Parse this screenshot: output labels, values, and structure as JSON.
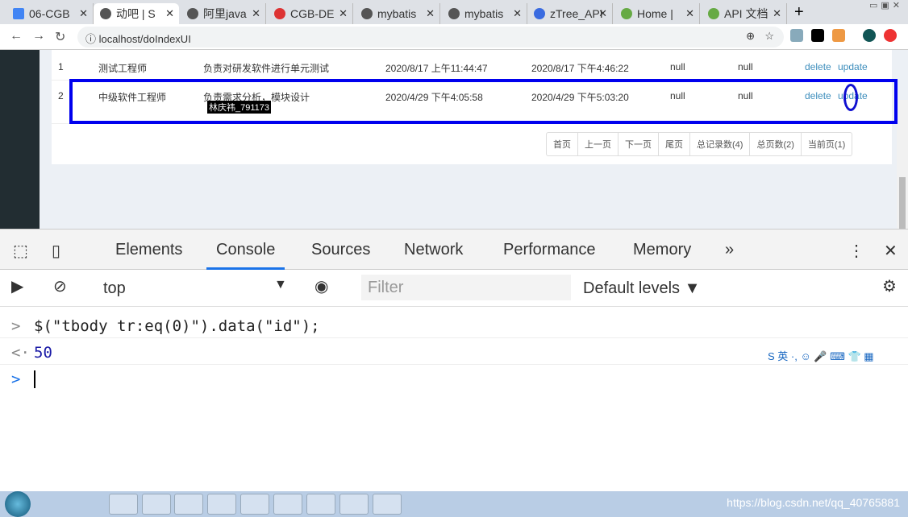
{
  "browser": {
    "tabs": [
      {
        "label": "06-CGB",
        "active": false
      },
      {
        "label": "动吧 | S",
        "active": true
      },
      {
        "label": "阿里java",
        "active": false
      },
      {
        "label": "CGB-DE",
        "active": false
      },
      {
        "label": "mybatis",
        "active": false
      },
      {
        "label": "mybatis",
        "active": false
      },
      {
        "label": "zTree_API",
        "active": false
      },
      {
        "label": "Home |",
        "active": false
      },
      {
        "label": "API 文档",
        "active": false
      }
    ],
    "url": "localhost/doIndexUI"
  },
  "table": {
    "rows": [
      {
        "no": "1",
        "name": "测试工程师",
        "note": "负责对研发软件进行单元测试",
        "created": "2020/8/17 上午11:44:47",
        "modified": "2020/8/17 下午4:46:22",
        "c1": "null",
        "c2": "null",
        "delete": "delete",
        "update": "update"
      },
      {
        "no": "2",
        "name": "中级软件工程师",
        "note": "负责需求分析，模块设计",
        "created": "2020/4/29 下午4:05:58",
        "modified": "2020/4/29 下午5:03:20",
        "c1": "null",
        "c2": "null",
        "delete": "delete",
        "update": "update"
      }
    ],
    "watermark": "林庆祎_791173"
  },
  "pager": [
    "首页",
    "上一页",
    "下一页",
    "尾页",
    "总记录数(4)",
    "总页数(2)",
    "当前页(1)"
  ],
  "devtools": {
    "tabs": [
      "Elements",
      "Console",
      "Sources",
      "Network",
      "Performance",
      "Memory"
    ],
    "active": "Console",
    "more": "»",
    "context": "top",
    "filter_placeholder": "Filter",
    "levels": "Default levels ▼",
    "lines": [
      {
        "prompt": ">",
        "text": "$(\"tbody tr:eq(0)\").data(\"id\");"
      },
      {
        "prompt": "<·",
        "text": "50"
      }
    ],
    "input_prompt": ">"
  },
  "ime": "S 英 ·, ☺ 🎤 ⌨ 👕 ▦",
  "taskbar": {
    "watermark": "https://blog.csdn.net/qq_40765881"
  }
}
